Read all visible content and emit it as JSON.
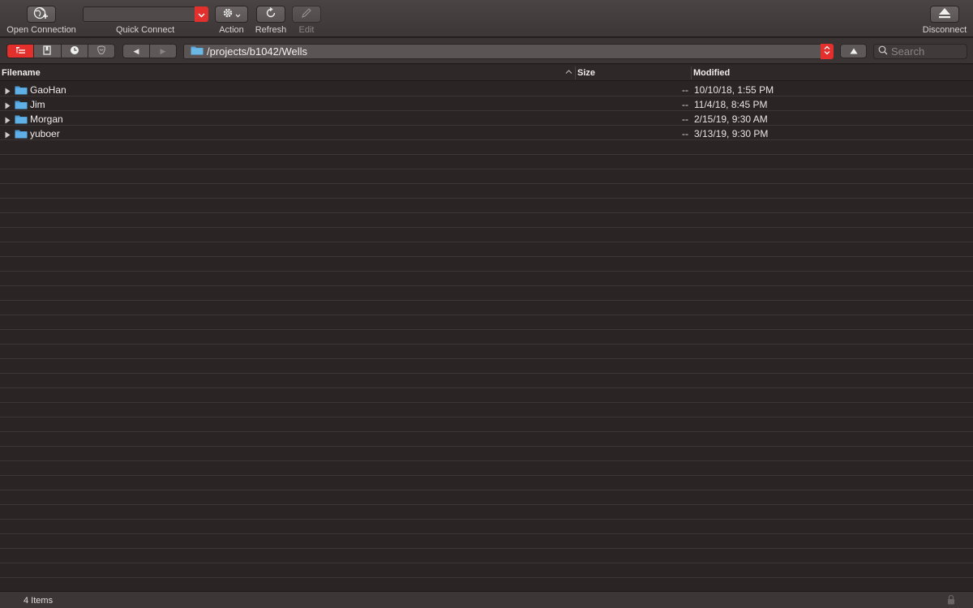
{
  "toolbar": {
    "open_connection": "Open Connection",
    "quick_connect": "Quick Connect",
    "action": "Action",
    "refresh": "Refresh",
    "edit": "Edit",
    "disconnect": "Disconnect"
  },
  "navbar": {
    "views": [
      "browser-icon",
      "bookmarks-icon",
      "history-icon",
      "bonjour-icon"
    ],
    "active_view": "browser-icon",
    "path": "/projects/b1042/Wells",
    "search_placeholder": "Search"
  },
  "table": {
    "columns": {
      "filename": "Filename",
      "size": "Size",
      "modified": "Modified"
    },
    "rows": [
      {
        "name": "GaoHan",
        "size": "--",
        "modified": "10/10/18, 1:55 PM"
      },
      {
        "name": "Jim",
        "size": "--",
        "modified": "11/4/18, 8:45 PM"
      },
      {
        "name": "Morgan",
        "size": "--",
        "modified": "2/15/19, 9:30 AM"
      },
      {
        "name": "yuboer",
        "size": "--",
        "modified": "3/13/19, 9:30 PM"
      }
    ]
  },
  "status": {
    "item_count": "4 Items"
  },
  "colors": {
    "accent": "#e3302c",
    "folder": "#5aa9dd",
    "background": "#2b2424"
  }
}
